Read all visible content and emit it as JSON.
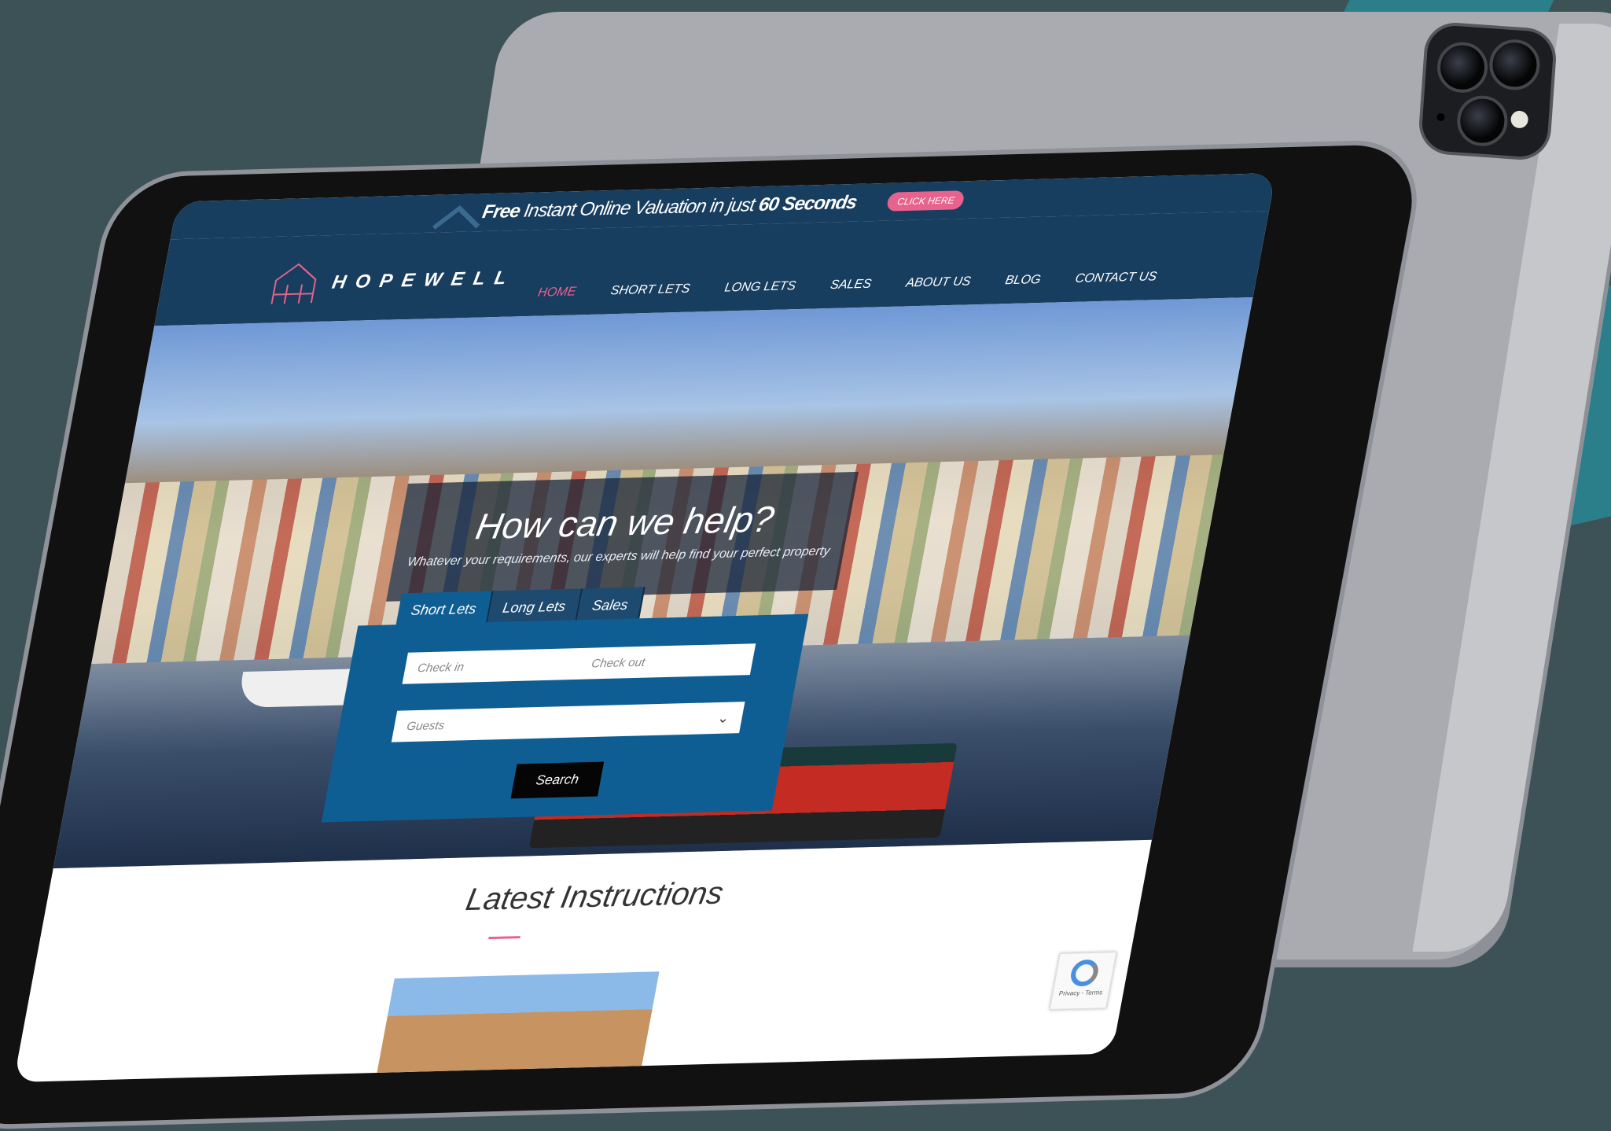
{
  "banner": {
    "free": "Free",
    "text": "Instant Online Valuation in just",
    "highlight": "60 Seconds",
    "button": "CLICK HERE"
  },
  "brand": {
    "name": "HOPEWELL"
  },
  "nav": {
    "items": [
      "HOME",
      "SHORT LETS",
      "LONG LETS",
      "SALES",
      "ABOUT US",
      "BLOG",
      "CONTACT US"
    ],
    "active": "HOME"
  },
  "hero": {
    "title": "How can we help?",
    "subtitle": "Whatever your requirements, our experts will help find your perfect property"
  },
  "search": {
    "tabs": [
      "Short Lets",
      "Long Lets",
      "Sales"
    ],
    "active_tab": "Short Lets",
    "check_in_placeholder": "Check in",
    "check_out_placeholder": "Check out",
    "guests_placeholder": "Guests",
    "button": "Search"
  },
  "section": {
    "title": "Latest Instructions"
  },
  "recaptcha": {
    "label": "Privacy - Terms"
  },
  "colors": {
    "navy": "#173d5f",
    "accent": "#e7628c",
    "panel": "#0f5e93"
  }
}
